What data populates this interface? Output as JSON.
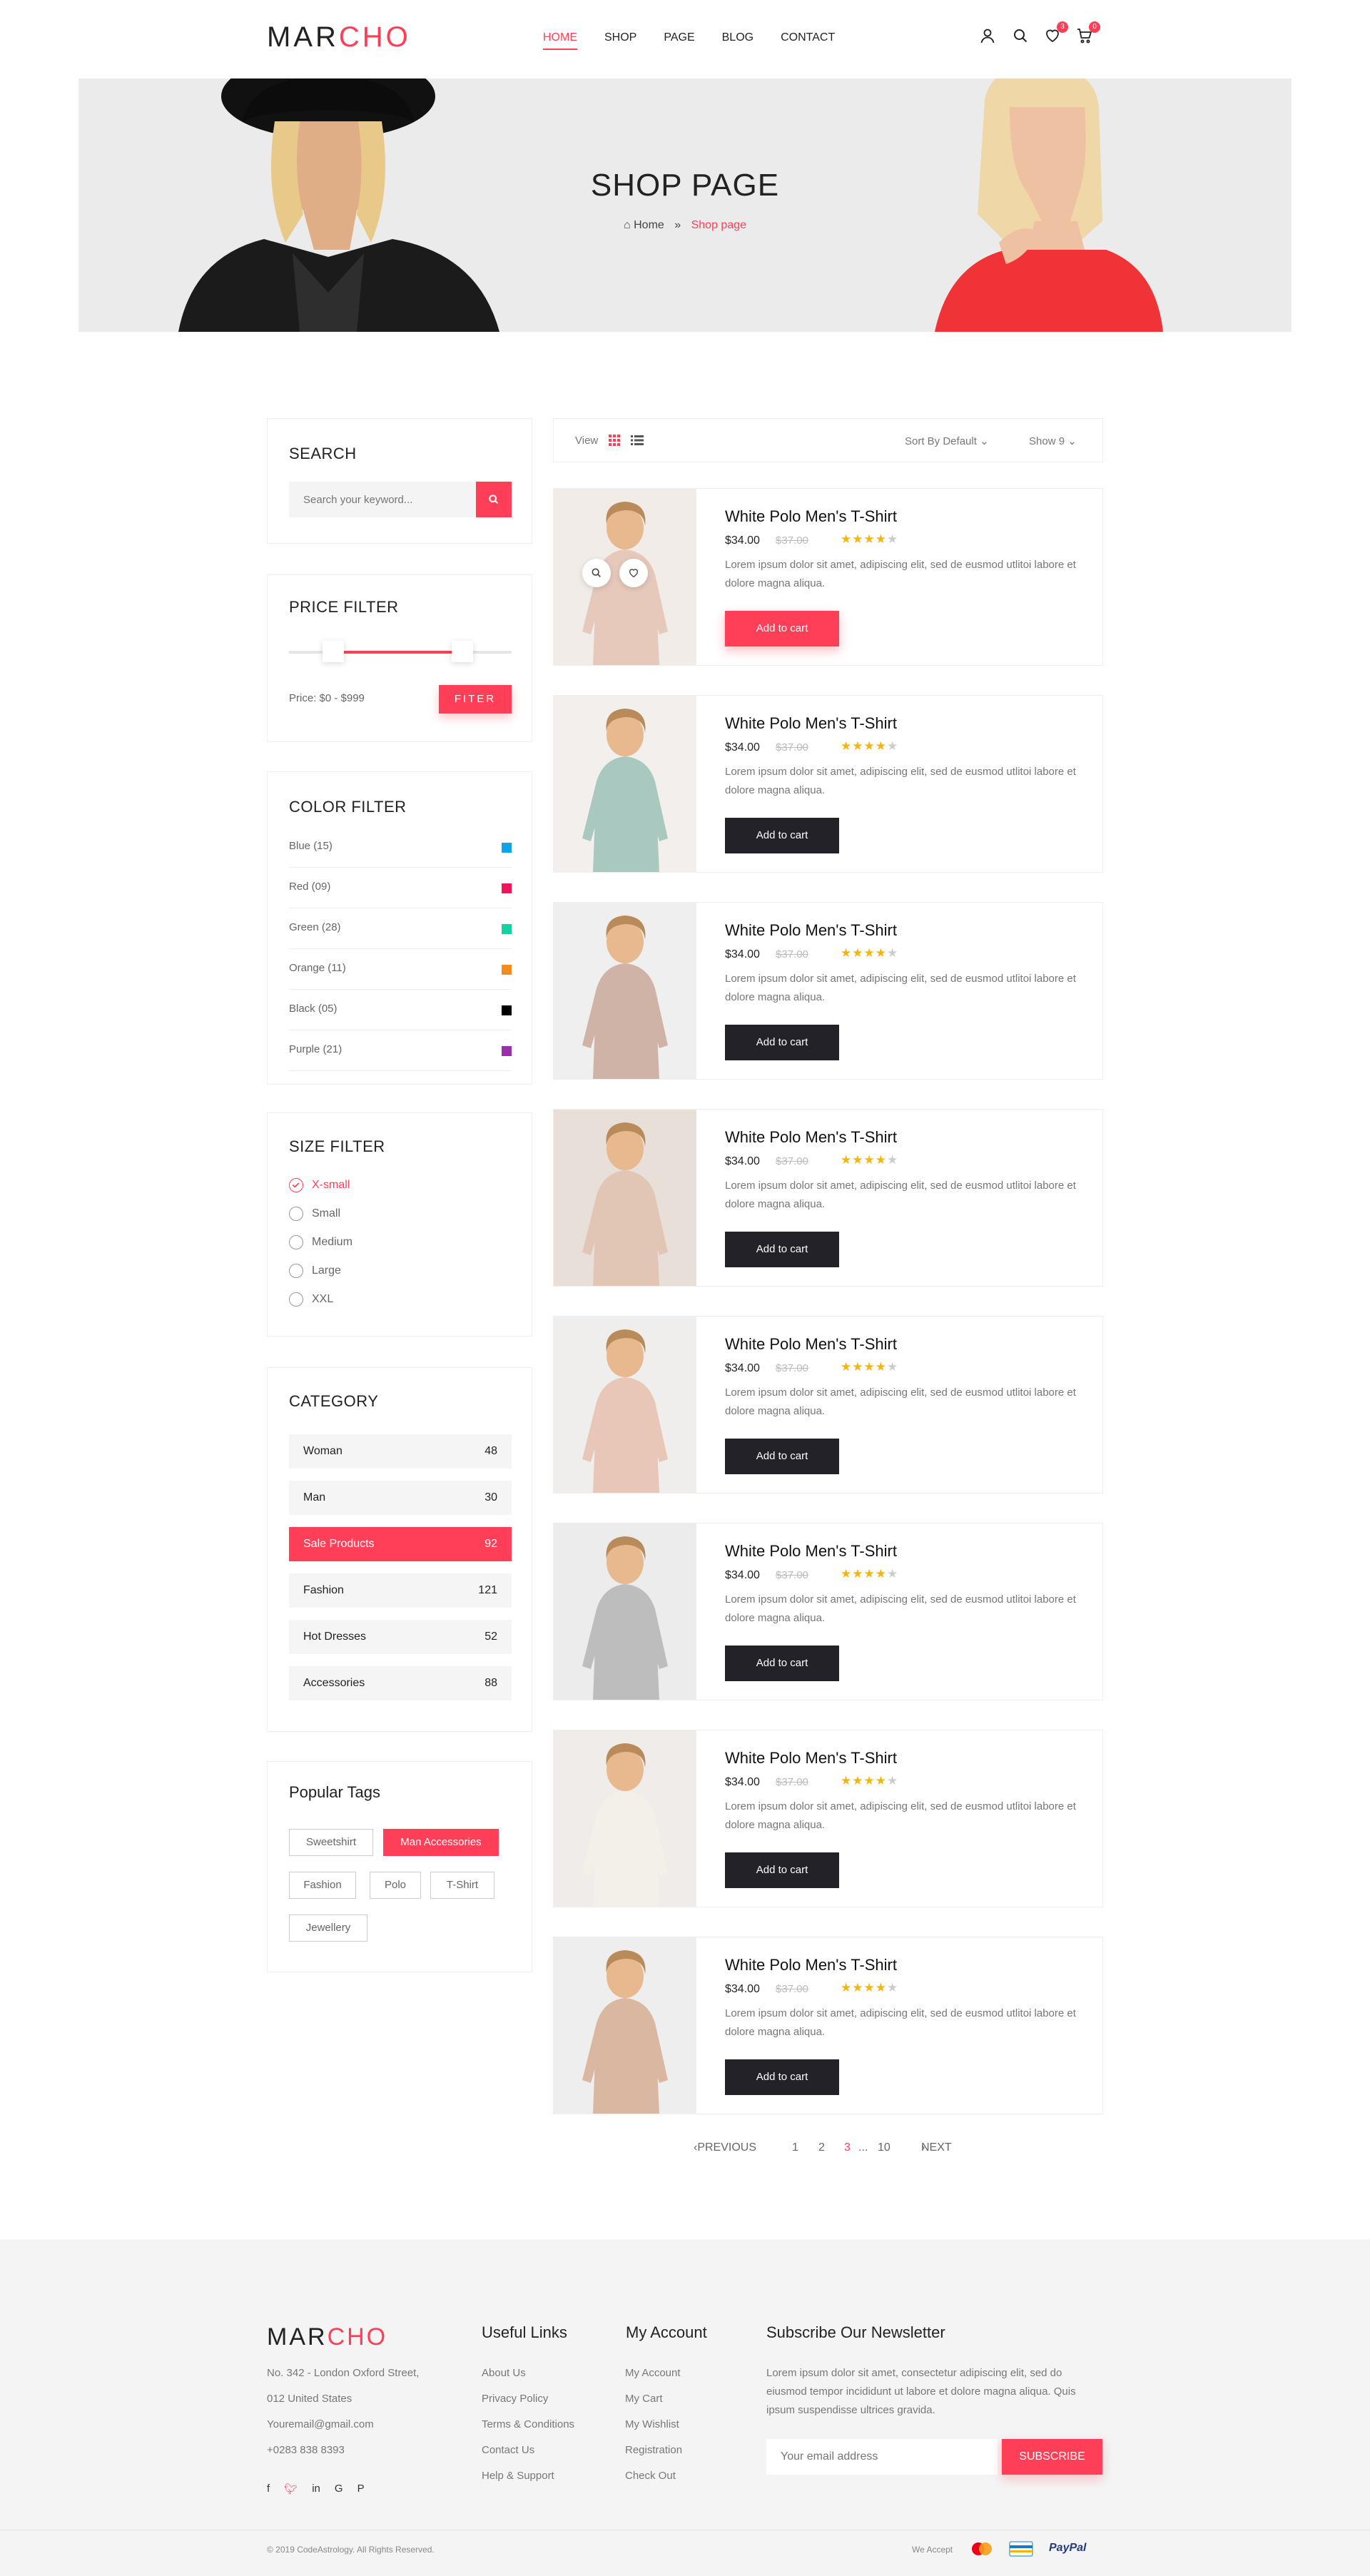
{
  "brand": {
    "logo_a": "MAR",
    "logo_b": "CHO",
    "accent": "#ff3e57",
    "dark": "#222228"
  },
  "nav": [
    "HOME",
    "SHOP",
    "PAGE",
    "BLOG",
    "CONTACT"
  ],
  "header": {
    "wishlist_count": "3",
    "cart_count": "0"
  },
  "banner": {
    "title": "SHOP PAGE",
    "home": "Home",
    "current": "Shop page"
  },
  "sidebar": {
    "search": {
      "title": "SEARCH",
      "placeholder": "Search your keyword..."
    },
    "price": {
      "title": "PRICE FILTER",
      "label": "Price: $0 - $999",
      "button": "FITER",
      "min_fraction": 0.2,
      "max_fraction": 0.78
    },
    "color": {
      "title": "COLOR FILTER",
      "items": [
        {
          "label": "Blue (15)",
          "color": "#11a3e8"
        },
        {
          "label": "Red (09)",
          "color": "#f0145a"
        },
        {
          "label": "Green (28)",
          "color": "#13d3a5"
        },
        {
          "label": "Orange (11)",
          "color": "#f58b1c"
        },
        {
          "label": "Black (05)",
          "color": "#000000"
        },
        {
          "label": "Purple (21)",
          "color": "#9b2fae"
        }
      ]
    },
    "size": {
      "title": "SIZE FILTER",
      "items": [
        "X-small",
        "Small",
        "Medium",
        "Large",
        "XXL"
      ],
      "selected": "X-small"
    },
    "category": {
      "title": "CATEGORY",
      "items": [
        {
          "name": "Woman",
          "count": "48"
        },
        {
          "name": "Man",
          "count": "30"
        },
        {
          "name": "Sale Products",
          "count": "92"
        },
        {
          "name": "Fashion",
          "count": "121"
        },
        {
          "name": "Hot Dresses",
          "count": "52"
        },
        {
          "name": "Accessories",
          "count": "88"
        }
      ],
      "active": "Sale Products"
    },
    "tags": {
      "title": "Popular Tags",
      "items": [
        "Sweetshirt",
        "Man Accessories",
        "Fashion",
        "Polo",
        "T-Shirt",
        "Jewellery"
      ],
      "active": "Man Accessories"
    }
  },
  "toolbar": {
    "view": "View",
    "sort": "Sort By Default",
    "show": "Show 9"
  },
  "products": [
    {
      "name": "White Polo Men's T-Shirt",
      "price": "$34.00",
      "old_price": "$37.00",
      "rating": 4,
      "desc": "Lorem ipsum dolor sit amet, adipiscing elit, sed de eusmod  utlitoi labore et dolore magna aliqua.",
      "button": "Add to cart"
    },
    {
      "name": "White Polo Men's T-Shirt",
      "price": "$34.00",
      "old_price": "$37.00",
      "rating": 4,
      "desc": "Lorem ipsum dolor sit amet, adipiscing elit, sed de eusmod  utlitoi labore et dolore magna aliqua.",
      "button": "Add to cart"
    },
    {
      "name": "White Polo Men's T-Shirt",
      "price": "$34.00",
      "old_price": "$37.00",
      "rating": 4,
      "desc": "Lorem ipsum dolor sit amet, adipiscing elit, sed de eusmod  utlitoi labore et dolore magna aliqua.",
      "button": "Add to cart"
    },
    {
      "name": "White Polo Men's T-Shirt",
      "price": "$34.00",
      "old_price": "$37.00",
      "rating": 4,
      "desc": "Lorem ipsum dolor sit amet, adipiscing elit, sed de eusmod  utlitoi labore et dolore magna aliqua.",
      "button": "Add to cart"
    },
    {
      "name": "White Polo Men's T-Shirt",
      "price": "$34.00",
      "old_price": "$37.00",
      "rating": 4,
      "desc": "Lorem ipsum dolor sit amet, adipiscing elit, sed de eusmod  utlitoi labore et dolore magna aliqua.",
      "button": "Add to cart"
    },
    {
      "name": "White Polo Men's T-Shirt",
      "price": "$34.00",
      "old_price": "$37.00",
      "rating": 4,
      "desc": "Lorem ipsum dolor sit amet, adipiscing elit, sed de eusmod  utlitoi labore et dolore magna aliqua.",
      "button": "Add to cart"
    },
    {
      "name": "White Polo Men's T-Shirt",
      "price": "$34.00",
      "old_price": "$37.00",
      "rating": 4,
      "desc": "Lorem ipsum dolor sit amet, adipiscing elit, sed de eusmod  utlitoi labore et dolore magna aliqua.",
      "button": "Add to cart"
    },
    {
      "name": "White Polo Men's T-Shirt",
      "price": "$34.00",
      "old_price": "$37.00",
      "rating": 4,
      "desc": "Lorem ipsum dolor sit amet, adipiscing elit, sed de eusmod  utlitoi labore et dolore magna aliqua.",
      "button": "Add to cart"
    }
  ],
  "pagination": {
    "previous": "PREVIOUS",
    "pages": [
      "1",
      "2",
      "3"
    ],
    "current": "3",
    "ellipsis": "...",
    "last": "10",
    "next": "NEXT"
  },
  "footer": {
    "address": [
      "No. 342 - London Oxford Street,",
      "012 United States",
      "Youremail@gmail.com",
      "+0283 838 8393"
    ],
    "useful_title": "Useful Links",
    "useful": [
      "About Us",
      "Privacy Policy",
      "Terms & Conditions",
      "Contact Us",
      "Help & Support"
    ],
    "account_title": "My Account",
    "account": [
      "My Account",
      "My Cart",
      "My Wishlist",
      "Registration",
      "Check Out"
    ],
    "newsletter_title": "Subscribe Our Newsletter",
    "newsletter_text": "Lorem ipsum dolor sit amet, consectetur adipiscing elit, sed do eiusmod tempor incididunt ut labore et dolore magna aliqua. Quis ipsum suspendisse ultrices gravida.",
    "email_placeholder": "Your email address",
    "subscribe": "SUBSCRIBE",
    "copyright": "© 2019 CodeAstrology. All Rights Reserved.",
    "we_accept": "We Accept",
    "paypal": "PayPal"
  }
}
